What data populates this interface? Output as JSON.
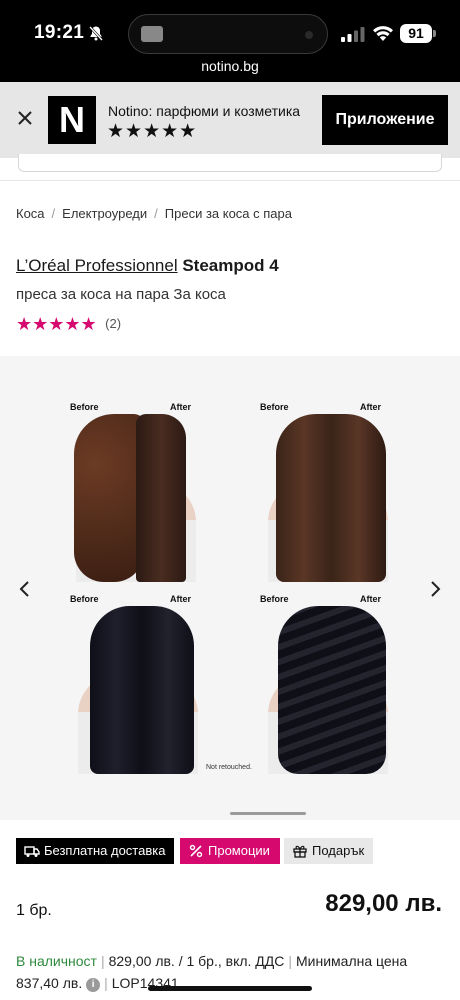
{
  "status_bar": {
    "time": "19:21",
    "battery": "91"
  },
  "browser": {
    "url": "notino.bg"
  },
  "app_banner": {
    "title": "Notino: парфюми и козметика",
    "stars": "★★★★★",
    "button": "Приложение",
    "logo": "N"
  },
  "breadcrumb": [
    "Коса",
    "Електроуреди",
    "Преси за коса с пара"
  ],
  "product": {
    "brand": "L’Oréal Professionnel",
    "name": "Steampod 4",
    "subtitle": "преса за коса на пара За коса",
    "rating_stars": "★★★★★",
    "rating_count": "(2)"
  },
  "gallery": {
    "before_label": "Before",
    "after_label": "After",
    "note": "Not retouched.",
    "prev_arrow": "‹",
    "next_arrow": "›"
  },
  "badges": {
    "delivery": "Безплатна доставка",
    "promo": "Промоции",
    "gift": "Подарък"
  },
  "purchase": {
    "quantity": "1 бр.",
    "price": "829,00 лв."
  },
  "stock": {
    "status": "В наличност",
    "unit_price": "829,00 лв. / 1 бр., вкл. ДДС",
    "min_price": "Минимална цена 837,40 лв.",
    "code": "LOP14341"
  },
  "colors": {
    "accent_pink": "#d6096f",
    "stock_green": "#2f8a3e"
  }
}
